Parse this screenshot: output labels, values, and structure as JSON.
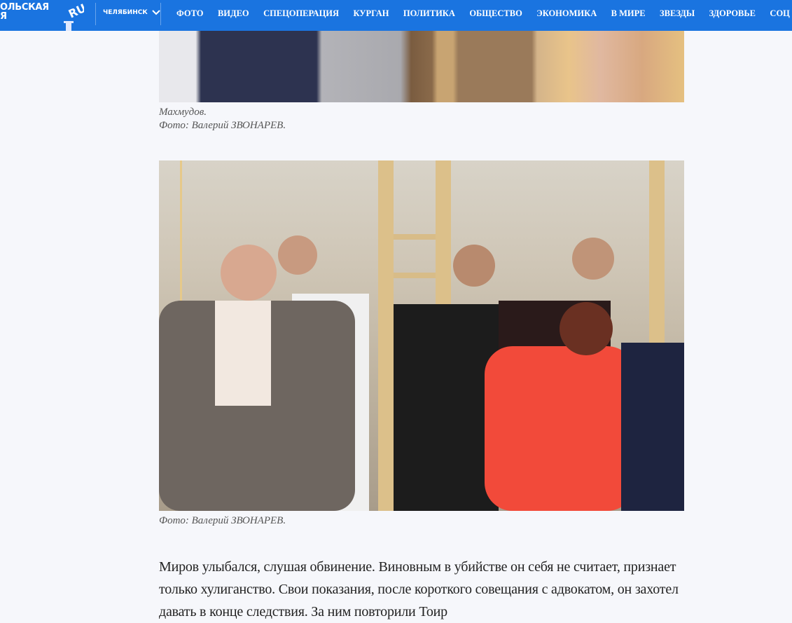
{
  "header": {
    "logo_text": "ОЛЬСКАЯ\nЯ",
    "logo_ru": "RU",
    "city": "ЧЕЛЯБИНСК",
    "nav": [
      "ФОТО",
      "ВИДЕО",
      "СПЕЦОПЕРАЦИЯ",
      "КУРГАН",
      "ПОЛИТИКА",
      "ОБЩЕСТВО",
      "ЭКОНОМИКА",
      "В МИРЕ",
      "ЗВЕЗДЫ",
      "ЗДОРОВЬЕ",
      "СОЦ"
    ],
    "color": "#1a74e0"
  },
  "article": {
    "photo1_caption": "Махмудов.",
    "photo1_credit": "Фото: Валерий ЗВОНАРЕВ.",
    "photo2_credit": "Фото: Валерий ЗВОНАРЕВ.",
    "paragraph": "Миров улыбался, слушая обвинение. Виновным в убийстве он себя не считает, признает только хулиганство. Свои показания, после короткого совещания с адвокатом, он захотел давать в конце следствия. За ним повторили Тоир"
  }
}
